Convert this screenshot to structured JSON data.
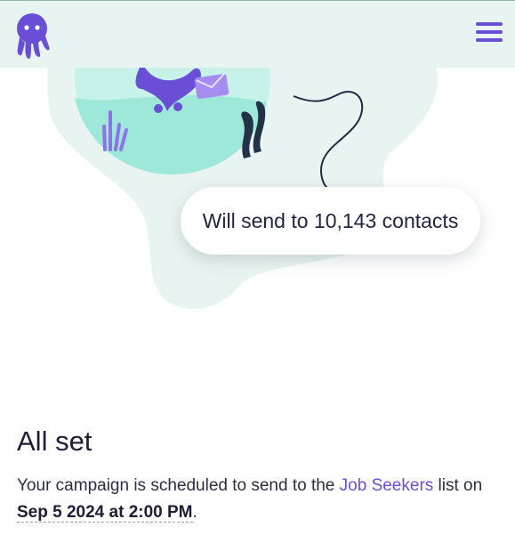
{
  "header": {
    "logo_icon": "octopus-logo-icon",
    "menu_icon": "hamburger-menu-icon"
  },
  "illustration": {
    "badge_text": "Will send to 10,143 contacts"
  },
  "main": {
    "title": "All set",
    "desc_prefix": "Your campaign is scheduled to send to the ",
    "list_name": "Job Seekers",
    "desc_middle": " list on ",
    "send_date": "Sep 5 2024 at 2:00 PM",
    "desc_suffix": "."
  },
  "colors": {
    "brand_purple": "#6a4fd6",
    "header_bg": "#e8f4f1",
    "blob_bg": "#e8f4f1",
    "water": "#a7eadc"
  }
}
